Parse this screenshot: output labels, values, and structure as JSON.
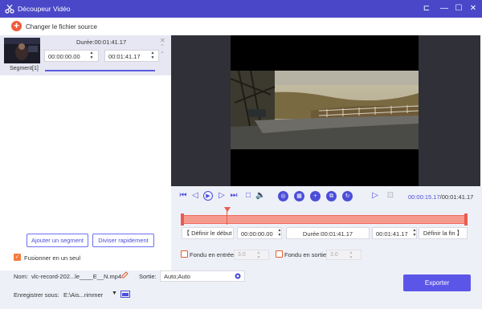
{
  "window": {
    "title": "Découpeur Vidéo"
  },
  "toolbar": {
    "change_source_label": "Changer le fichier source"
  },
  "segment": {
    "duration_label": "Durée:00:01:41.17",
    "start_time": "00:00:00.00",
    "end_time": "00:01:41.17",
    "label": "Segment[1]"
  },
  "left_actions": {
    "add_segment_label": "Ajouter un segment",
    "split_label": "Diviser rapidement",
    "merge_label": "Fusionner en un seul",
    "merge_checked": true
  },
  "player": {
    "current_time": "00:00:15.17",
    "total_time": "/00:01:41.17",
    "playhead_fraction": 0.15
  },
  "range": {
    "set_start_label": "Définir le début",
    "start_value": "00:00:00.00",
    "duration_label": "Durée:00:01:41.17",
    "end_value": "00:01:41.17",
    "set_end_label": "Définir la fin"
  },
  "fade": {
    "fade_in_label": "Fondu en entrée",
    "fade_in_value": "3.0",
    "fade_out_label": "Fondu en sortie",
    "fade_out_value": "3.0"
  },
  "output": {
    "name_label": "Nom:",
    "name_value": "vlc-record-202...le____E__N.mp4",
    "output_label": "Sortie:",
    "output_value": "Auto;Auto",
    "save_label": "Enregistrer sous:",
    "save_path": "E:\\Ais...rimmer",
    "export_label": "Exporter"
  },
  "colors": {
    "accent": "#4b4ed8",
    "title_bar": "#4a48c8",
    "timeline": "#f59a8f",
    "orange": "#f47b3e"
  },
  "icons": [
    "scissors-logo-icon",
    "pin-icon",
    "minimize-icon",
    "maximize-icon",
    "close-icon",
    "plus-icon",
    "skip-start-icon",
    "prev-frame-icon",
    "play-icon",
    "next-frame-icon",
    "skip-end-icon",
    "stop-icon",
    "volume-icon",
    "edit-pencil-icon",
    "gear-icon",
    "folder-icon"
  ]
}
